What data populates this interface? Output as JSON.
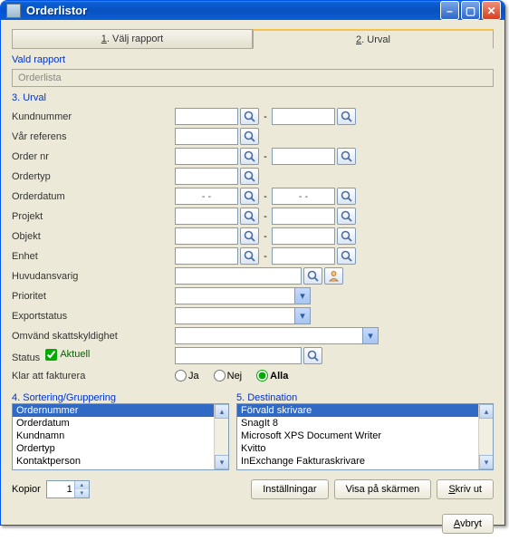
{
  "window": {
    "title": "Orderlistor"
  },
  "tabs": {
    "t1_num": "1",
    "t1_label": ". Välj rapport",
    "t2_num": "2",
    "t2_label": ". Urval"
  },
  "vald_rapport": {
    "label": "Vald rapport",
    "value": "Orderlista"
  },
  "urval": {
    "label": "3. Urval",
    "kundnummer": "Kundnummer",
    "var_referens": "Vår referens",
    "order_nr": "Order nr",
    "ordertyp": "Ordertyp",
    "orderdatum": "Orderdatum",
    "orderdatum_from": "- -",
    "orderdatum_to": "- -",
    "projekt": "Projekt",
    "objekt": "Objekt",
    "enhet": "Enhet",
    "huvudansvarig": "Huvudansvarig",
    "prioritet": "Prioritet",
    "exportstatus": "Exportstatus",
    "omvand": "Omvänd skattskyldighet",
    "status_label": "Status",
    "status_chk": "Aktuell",
    "klar_label": "Klar att fakturera",
    "ja": "Ja",
    "nej": "Nej",
    "alla": "Alla",
    "dash": "-"
  },
  "sort": {
    "label": "4. Sortering/Gruppering",
    "items": [
      "Ordernummer",
      "Orderdatum",
      "Kundnamn",
      "Ordertyp",
      "Kontaktperson"
    ],
    "selected": 0
  },
  "dest": {
    "label": "5. Destination",
    "items": [
      "Förvald skrivare",
      "SnagIt 8",
      "Microsoft XPS Document Writer",
      "Kvitto",
      "InExchange Fakturaskrivare"
    ],
    "selected": 0
  },
  "kopior": {
    "label": "Kopior",
    "value": "1"
  },
  "buttons": {
    "installningar": "Inställningar",
    "visa": "Visa på skärmen",
    "skrivut": "Skriv ut",
    "avbryt": "Avbryt"
  }
}
